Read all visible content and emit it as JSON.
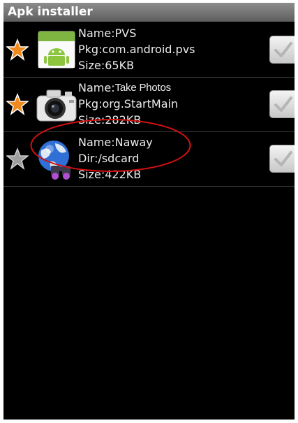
{
  "app": {
    "title": "Apk installer"
  },
  "items": [
    {
      "starred": true,
      "icon": "android-app-icon",
      "name_label": "Name:",
      "name": "PVS",
      "detail_label": "Pkg:",
      "detail": "com.android.pvs",
      "size_label": "Size:",
      "size": "65KB",
      "checked": false
    },
    {
      "starred": true,
      "icon": "camera-icon",
      "name_label": "Name:",
      "name": "Take Photos",
      "detail_label": "Pkg:",
      "detail": "org.StartMain",
      "size_label": "Size:",
      "size": "282KB",
      "checked": false
    },
    {
      "starred": false,
      "icon": "globe-binoculars-icon",
      "name_label": "Name:",
      "name": "Naway",
      "detail_label": "Dir:",
      "detail": "/sdcard",
      "size_label": "Size:",
      "size": "422KB",
      "checked": false,
      "highlighted": true
    }
  ],
  "colors": {
    "star_on": "#f08a1c",
    "star_off": "#9e9e9e",
    "highlight": "#d01010"
  }
}
